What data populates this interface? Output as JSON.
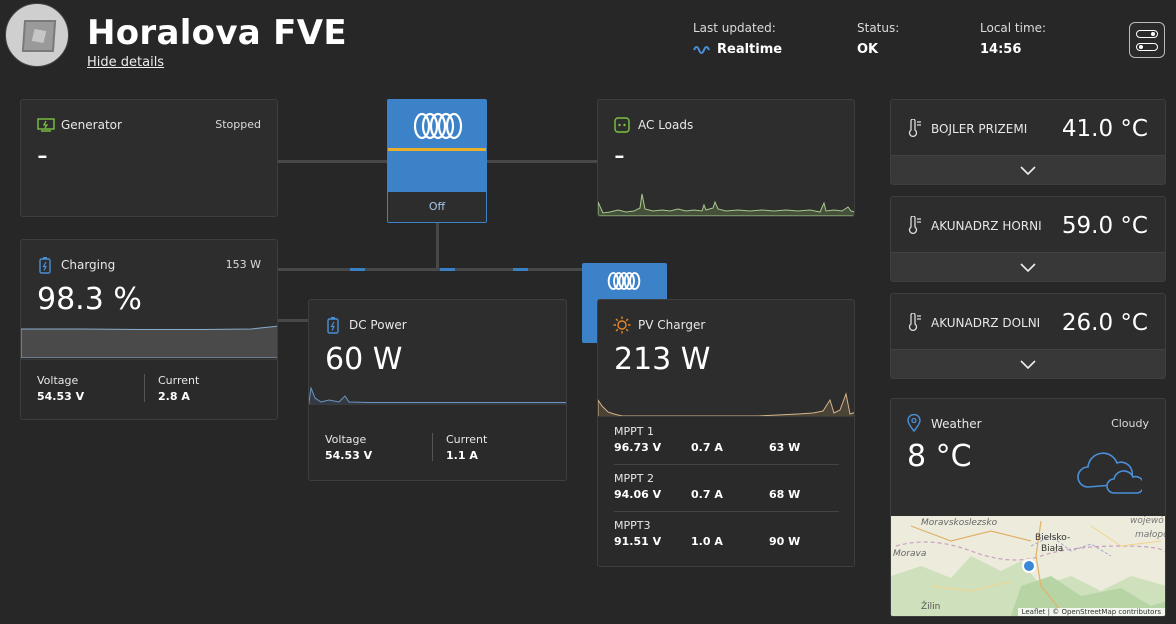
{
  "header": {
    "title": "Horalova FVE",
    "hide_details": "Hide details",
    "last_updated_label": "Last updated:",
    "last_updated_value": "Realtime",
    "status_label": "Status:",
    "status_value": "OK",
    "local_time_label": "Local time:",
    "local_time_value": "14:56"
  },
  "generator": {
    "title": "Generator",
    "status": "Stopped",
    "value": "-"
  },
  "inverter": {
    "state": "Off"
  },
  "ac_loads": {
    "title": "AC Loads",
    "value": "-"
  },
  "battery": {
    "title": "Charging",
    "power": "153 W",
    "soc": "98.3 %",
    "voltage_label": "Voltage",
    "voltage": "54.53 V",
    "current_label": "Current",
    "current": "2.8 A"
  },
  "dc_power": {
    "title": "DC Power",
    "value": "60 W",
    "voltage_label": "Voltage",
    "voltage": "54.53 V",
    "current_label": "Current",
    "current": "1.1 A"
  },
  "pv_charger": {
    "title": "PV Charger",
    "value": "213 W",
    "mppts": [
      {
        "name": "MPPT 1",
        "voltage": "96.73 V",
        "current": "0.7 A",
        "power": "63 W"
      },
      {
        "name": "MPPT 2",
        "voltage": "94.06 V",
        "current": "0.7 A",
        "power": "68 W"
      },
      {
        "name": "MPPT3",
        "voltage": "91.51 V",
        "current": "1.0 A",
        "power": "90 W"
      }
    ]
  },
  "temperatures": [
    {
      "name": "BOJLER PRIZEMI",
      "value": "41.0 °C"
    },
    {
      "name": "AKUNADRZ HORNI",
      "value": "59.0 °C"
    },
    {
      "name": "AKUNADRZ DOLNI",
      "value": "26.0 °C"
    }
  ],
  "weather": {
    "title": "Weather",
    "condition": "Cloudy",
    "temperature": "8 °C",
    "map": {
      "labels": [
        "Moravskoslezsko",
        "Morava",
        "Bielsko-",
        "Biała",
        "wojewó",
        "małopo",
        "Žilin"
      ],
      "attribution": "Leaflet | © OpenStreetMap contributors"
    }
  },
  "colors": {
    "background": "#272727",
    "card": "#2d2d2d",
    "victron_blue": "#3c82c8",
    "battery_icon": "#4a90d9",
    "pv_icon": "#e8862b",
    "ac_icon": "#7cc242",
    "generator_icon": "#7cc242"
  }
}
